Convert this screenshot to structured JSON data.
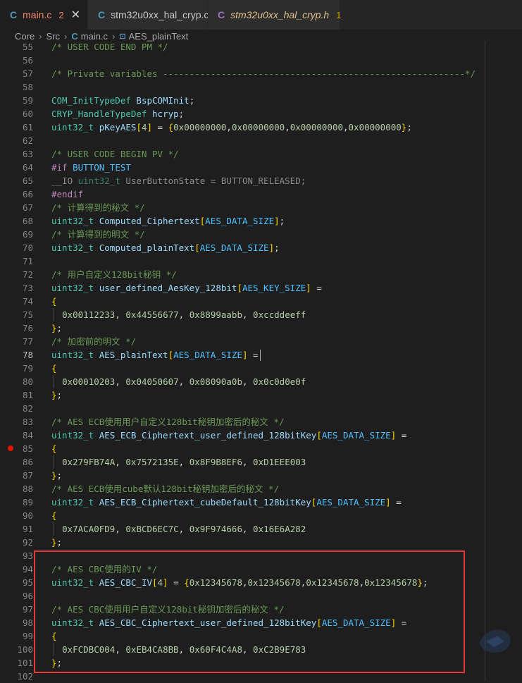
{
  "tabs": [
    {
      "label": "main.c",
      "badge": "2",
      "active": true,
      "style": "mod",
      "icon": "c-file-icon"
    },
    {
      "label": "stm32u0xx_hal_cryp.c",
      "badge": "",
      "active": false,
      "style": "",
      "icon": "c-file-icon"
    },
    {
      "label": "stm32u0xx_hal_cryp.h",
      "badge": "1",
      "active": false,
      "style": "warn",
      "icon": "c-header-icon"
    }
  ],
  "breadcrumb": [
    "Core",
    "Src",
    "main.c",
    "AES_plainText"
  ],
  "icons": {
    "c_glyph": "C",
    "close": "✕",
    "sep": "›",
    "symbol": "⊡"
  },
  "current_line": 78,
  "breakpoint_line": 85,
  "code_lines": [
    {
      "n": 55,
      "t": [
        [
          "c-com",
          "/* USER CODE END PM */"
        ]
      ]
    },
    {
      "n": 56,
      "t": []
    },
    {
      "n": 57,
      "t": [
        [
          "c-com",
          "/* Private variables ---------------------------------------------------------*/"
        ]
      ]
    },
    {
      "n": 58,
      "t": []
    },
    {
      "n": 59,
      "t": [
        [
          "c-type",
          "COM_InitTypeDef"
        ],
        [
          "c-pl",
          " "
        ],
        [
          "c-id",
          "BspCOMInit"
        ],
        [
          "c-pl",
          ";"
        ]
      ]
    },
    {
      "n": 60,
      "t": [
        [
          "c-type",
          "CRYP_HandleTypeDef"
        ],
        [
          "c-pl",
          " "
        ],
        [
          "c-id",
          "hcryp"
        ],
        [
          "c-pl",
          ";"
        ]
      ]
    },
    {
      "n": 61,
      "t": [
        [
          "c-type",
          "uint32_t"
        ],
        [
          "c-pl",
          " "
        ],
        [
          "c-id",
          "pKeyAES"
        ],
        [
          "c-br",
          "["
        ],
        [
          "c-num",
          "4"
        ],
        [
          "c-br",
          "]"
        ],
        [
          "c-pl",
          " = "
        ],
        [
          "c-br",
          "{"
        ],
        [
          "c-num",
          "0x00000000"
        ],
        [
          "c-pl",
          ","
        ],
        [
          "c-num",
          "0x00000000"
        ],
        [
          "c-pl",
          ","
        ],
        [
          "c-num",
          "0x00000000"
        ],
        [
          "c-pl",
          ","
        ],
        [
          "c-num",
          "0x00000000"
        ],
        [
          "c-br",
          "}"
        ],
        [
          "c-pl",
          ";"
        ]
      ]
    },
    {
      "n": 62,
      "t": []
    },
    {
      "n": 63,
      "t": [
        [
          "c-com",
          "/* USER CODE BEGIN PV */"
        ]
      ]
    },
    {
      "n": 64,
      "t": [
        [
          "c-kw",
          "#if"
        ],
        [
          "c-pl",
          " "
        ],
        [
          "c-macro",
          "BUTTON_TEST"
        ]
      ]
    },
    {
      "n": 65,
      "t": [
        [
          "c-inact",
          "__IO "
        ],
        [
          "c-inact-type",
          "uint32_t"
        ],
        [
          "c-inact",
          " UserButtonState = BUTTON_RELEASED;"
        ]
      ]
    },
    {
      "n": 66,
      "t": [
        [
          "c-kw",
          "#endif"
        ]
      ]
    },
    {
      "n": 67,
      "t": [
        [
          "c-com",
          "/* 计算得到的秘文 */"
        ]
      ]
    },
    {
      "n": 68,
      "t": [
        [
          "c-type",
          "uint32_t"
        ],
        [
          "c-pl",
          " "
        ],
        [
          "c-id",
          "Computed_Ciphertext"
        ],
        [
          "c-br",
          "["
        ],
        [
          "c-macro",
          "AES_DATA_SIZE"
        ],
        [
          "c-br",
          "]"
        ],
        [
          "c-pl",
          ";"
        ]
      ]
    },
    {
      "n": 69,
      "t": [
        [
          "c-com",
          "/* 计算得到的明文 */"
        ]
      ]
    },
    {
      "n": 70,
      "t": [
        [
          "c-type",
          "uint32_t"
        ],
        [
          "c-pl",
          " "
        ],
        [
          "c-id",
          "Computed_plainText"
        ],
        [
          "c-br",
          "["
        ],
        [
          "c-macro",
          "AES_DATA_SIZE"
        ],
        [
          "c-br",
          "]"
        ],
        [
          "c-pl",
          ";"
        ]
      ]
    },
    {
      "n": 71,
      "t": []
    },
    {
      "n": 72,
      "t": [
        [
          "c-com",
          "/* 用户自定义128bit秘钥 */"
        ]
      ]
    },
    {
      "n": 73,
      "t": [
        [
          "c-type",
          "uint32_t"
        ],
        [
          "c-pl",
          " "
        ],
        [
          "c-id",
          "user_defined_AesKey_128bit"
        ],
        [
          "c-br",
          "["
        ],
        [
          "c-macro",
          "AES_KEY_SIZE"
        ],
        [
          "c-br",
          "]"
        ],
        [
          "c-pl",
          " ="
        ]
      ]
    },
    {
      "n": 74,
      "t": [
        [
          "c-br",
          "{"
        ]
      ]
    },
    {
      "n": 75,
      "t": [
        [
          "c-pl",
          "  "
        ],
        [
          "c-num",
          "0x00112233"
        ],
        [
          "c-pl",
          ", "
        ],
        [
          "c-num",
          "0x44556677"
        ],
        [
          "c-pl",
          ", "
        ],
        [
          "c-num",
          "0x8899aabb"
        ],
        [
          "c-pl",
          ", "
        ],
        [
          "c-num",
          "0xccddeeff"
        ]
      ]
    },
    {
      "n": 76,
      "t": [
        [
          "c-br",
          "}"
        ],
        [
          "c-pl",
          ";"
        ]
      ]
    },
    {
      "n": 77,
      "t": [
        [
          "c-com",
          "/* 加密前的明文 */"
        ]
      ]
    },
    {
      "n": 78,
      "t": [
        [
          "c-type",
          "uint32_t"
        ],
        [
          "c-pl",
          " "
        ],
        [
          "c-id",
          "AES_plainText"
        ],
        [
          "c-br",
          "["
        ],
        [
          "c-macro",
          "AES_DATA_SIZE"
        ],
        [
          "c-br",
          "]"
        ],
        [
          "c-pl",
          " ="
        ]
      ]
    },
    {
      "n": 79,
      "t": [
        [
          "c-br",
          "{"
        ]
      ]
    },
    {
      "n": 80,
      "t": [
        [
          "c-pl",
          "  "
        ],
        [
          "c-num",
          "0x00010203"
        ],
        [
          "c-pl",
          ", "
        ],
        [
          "c-num",
          "0x04050607"
        ],
        [
          "c-pl",
          ", "
        ],
        [
          "c-num",
          "0x08090a0b"
        ],
        [
          "c-pl",
          ", "
        ],
        [
          "c-num",
          "0x0c0d0e0f"
        ]
      ]
    },
    {
      "n": 81,
      "t": [
        [
          "c-br",
          "}"
        ],
        [
          "c-pl",
          ";"
        ]
      ]
    },
    {
      "n": 82,
      "t": []
    },
    {
      "n": 83,
      "t": [
        [
          "c-com",
          "/* AES ECB使用用户自定义128bit秘钥加密后的秘文 */"
        ]
      ]
    },
    {
      "n": 84,
      "t": [
        [
          "c-type",
          "uint32_t"
        ],
        [
          "c-pl",
          " "
        ],
        [
          "c-id",
          "AES_ECB_Ciphertext_user_defined_128bitKey"
        ],
        [
          "c-br",
          "["
        ],
        [
          "c-macro",
          "AES_DATA_SIZE"
        ],
        [
          "c-br",
          "]"
        ],
        [
          "c-pl",
          " ="
        ]
      ]
    },
    {
      "n": 85,
      "t": [
        [
          "c-br",
          "{"
        ]
      ]
    },
    {
      "n": 86,
      "t": [
        [
          "c-pl",
          "  "
        ],
        [
          "c-num",
          "0x279FB74A"
        ],
        [
          "c-pl",
          ", "
        ],
        [
          "c-num",
          "0x7572135E"
        ],
        [
          "c-pl",
          ", "
        ],
        [
          "c-num",
          "0x8F9B8EF6"
        ],
        [
          "c-pl",
          ", "
        ],
        [
          "c-num",
          "0xD1EEE003"
        ]
      ]
    },
    {
      "n": 87,
      "t": [
        [
          "c-br",
          "}"
        ],
        [
          "c-pl",
          ";"
        ]
      ]
    },
    {
      "n": 88,
      "t": [
        [
          "c-com",
          "/* AES ECB使用cube默认128bit秘钥加密后的秘文 */"
        ]
      ]
    },
    {
      "n": 89,
      "t": [
        [
          "c-type",
          "uint32_t"
        ],
        [
          "c-pl",
          " "
        ],
        [
          "c-id",
          "AES_ECB_Ciphertext_cubeDefault_128bitKey"
        ],
        [
          "c-br",
          "["
        ],
        [
          "c-macro",
          "AES_DATA_SIZE"
        ],
        [
          "c-br",
          "]"
        ],
        [
          "c-pl",
          " ="
        ]
      ]
    },
    {
      "n": 90,
      "t": [
        [
          "c-br",
          "{"
        ]
      ]
    },
    {
      "n": 91,
      "t": [
        [
          "c-pl",
          "  "
        ],
        [
          "c-num",
          "0x7ACA0FD9"
        ],
        [
          "c-pl",
          ", "
        ],
        [
          "c-num",
          "0xBCD6EC7C"
        ],
        [
          "c-pl",
          ", "
        ],
        [
          "c-num",
          "0x9F974666"
        ],
        [
          "c-pl",
          ", "
        ],
        [
          "c-num",
          "0x16E6A282"
        ]
      ]
    },
    {
      "n": 92,
      "t": [
        [
          "c-br",
          "}"
        ],
        [
          "c-pl",
          ";"
        ]
      ]
    },
    {
      "n": 93,
      "t": []
    },
    {
      "n": 94,
      "t": [
        [
          "c-com",
          "/* AES CBC使用的IV */"
        ]
      ]
    },
    {
      "n": 95,
      "t": [
        [
          "c-type",
          "uint32_t"
        ],
        [
          "c-pl",
          " "
        ],
        [
          "c-id",
          "AES_CBC_IV"
        ],
        [
          "c-br",
          "["
        ],
        [
          "c-num",
          "4"
        ],
        [
          "c-br",
          "]"
        ],
        [
          "c-pl",
          " = "
        ],
        [
          "c-br",
          "{"
        ],
        [
          "c-num",
          "0x12345678"
        ],
        [
          "c-pl",
          ","
        ],
        [
          "c-num",
          "0x12345678"
        ],
        [
          "c-pl",
          ","
        ],
        [
          "c-num",
          "0x12345678"
        ],
        [
          "c-pl",
          ","
        ],
        [
          "c-num",
          "0x12345678"
        ],
        [
          "c-br",
          "}"
        ],
        [
          "c-pl",
          ";"
        ]
      ]
    },
    {
      "n": 96,
      "t": []
    },
    {
      "n": 97,
      "t": [
        [
          "c-com",
          "/* AES CBC使用用户自定义128bit秘钥加密后的秘文 */"
        ]
      ]
    },
    {
      "n": 98,
      "t": [
        [
          "c-type",
          "uint32_t"
        ],
        [
          "c-pl",
          " "
        ],
        [
          "c-id",
          "AES_CBC_Ciphertext_user_defined_128bitKey"
        ],
        [
          "c-br",
          "["
        ],
        [
          "c-macro",
          "AES_DATA_SIZE"
        ],
        [
          "c-br",
          "]"
        ],
        [
          "c-pl",
          " ="
        ]
      ]
    },
    {
      "n": 99,
      "t": [
        [
          "c-br",
          "{"
        ]
      ]
    },
    {
      "n": 100,
      "t": [
        [
          "c-pl",
          "  "
        ],
        [
          "c-num",
          "0xFCDBC004"
        ],
        [
          "c-pl",
          ", "
        ],
        [
          "c-num",
          "0xEB4CA8BB"
        ],
        [
          "c-pl",
          ", "
        ],
        [
          "c-num",
          "0x60F4C4A8"
        ],
        [
          "c-pl",
          ", "
        ],
        [
          "c-num",
          "0xC2B9E783"
        ]
      ]
    },
    {
      "n": 101,
      "t": [
        [
          "c-br",
          "}"
        ],
        [
          "c-pl",
          ";"
        ]
      ]
    },
    {
      "n": 102,
      "t": []
    }
  ]
}
